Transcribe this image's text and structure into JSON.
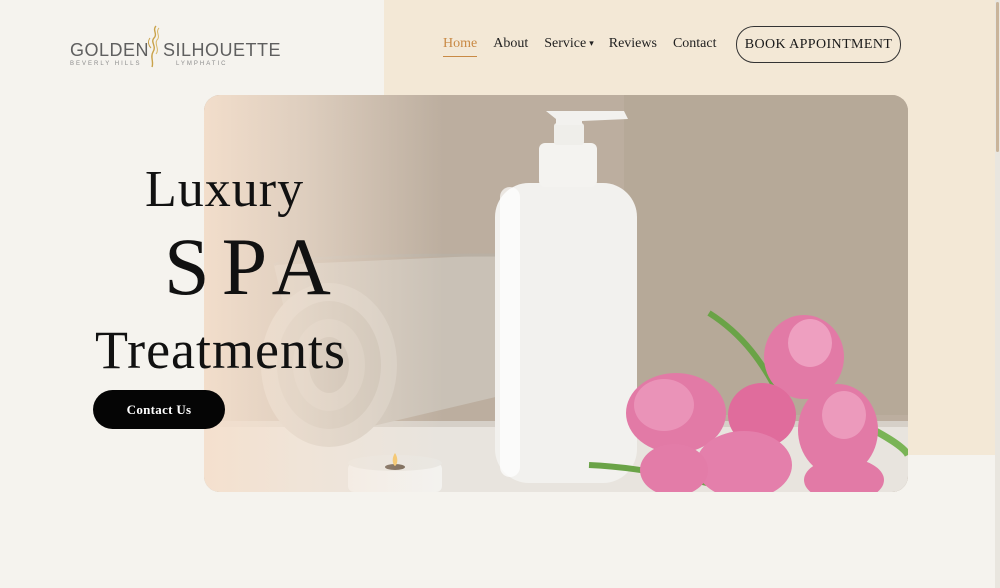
{
  "logo": {
    "left_word": "GOLDEN",
    "right_word": "SILHOUETTE",
    "sub_left": "BEVERLY HILLS",
    "sub_right": "LYMPHATIC"
  },
  "nav": {
    "items": [
      "Home",
      "About",
      "Service",
      "Reviews",
      "Contact"
    ],
    "active": "Home",
    "service_caret": "▾"
  },
  "header": {
    "book_label": "BOOK APPOINTMENT"
  },
  "hero": {
    "line1": "Luxury",
    "line2": "SPA",
    "line3": "Treatments",
    "cta_label": "Contact Us",
    "image_subjects": [
      "rolled-towel",
      "pump-bottle",
      "candle",
      "pink-tulips"
    ]
  },
  "colors": {
    "accent": "#c98a45",
    "page_bg": "#f5f3ee",
    "panel_bg": "#f3e8d6",
    "button_dark": "#050505",
    "tulip_pink": "#e27aa6"
  }
}
